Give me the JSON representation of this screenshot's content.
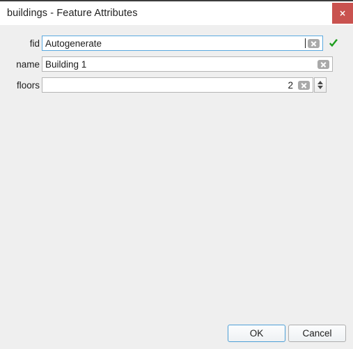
{
  "window": {
    "title": "buildings - Feature Attributes",
    "close_label": "×",
    "close_icon": "close-icon"
  },
  "colors": {
    "close_button_bg": "#c9524f",
    "focus_border": "#5aa9e0",
    "valid_check": "#1e9e1e",
    "dialog_bg": "#efefef",
    "titlebar_bg": "#ffffff",
    "field_bg": "#ffffff",
    "field_border": "#b5b5b5",
    "text": "#1c1c1c"
  },
  "form": {
    "fields": [
      {
        "label": "fid",
        "value": "Autogenerate",
        "placeholder": "",
        "type": "text",
        "focused": true,
        "has_caret": true,
        "clear_icon": "clear-icon",
        "valid_icon": "green-check-icon",
        "valid": true,
        "align": "left"
      },
      {
        "label": "name",
        "value": "Building 1",
        "placeholder": "",
        "type": "text",
        "focused": false,
        "has_caret": false,
        "clear_icon": "clear-icon",
        "valid": false,
        "align": "left"
      },
      {
        "label": "floors",
        "value": "2",
        "placeholder": "",
        "type": "spinbox",
        "focused": false,
        "has_caret": false,
        "clear_icon": "clear-icon",
        "spinner_up": "spinner-up-icon",
        "spinner_down": "spinner-down-icon",
        "valid": false,
        "align": "right"
      }
    ]
  },
  "footer": {
    "ok_label": "OK",
    "cancel_label": "Cancel"
  }
}
